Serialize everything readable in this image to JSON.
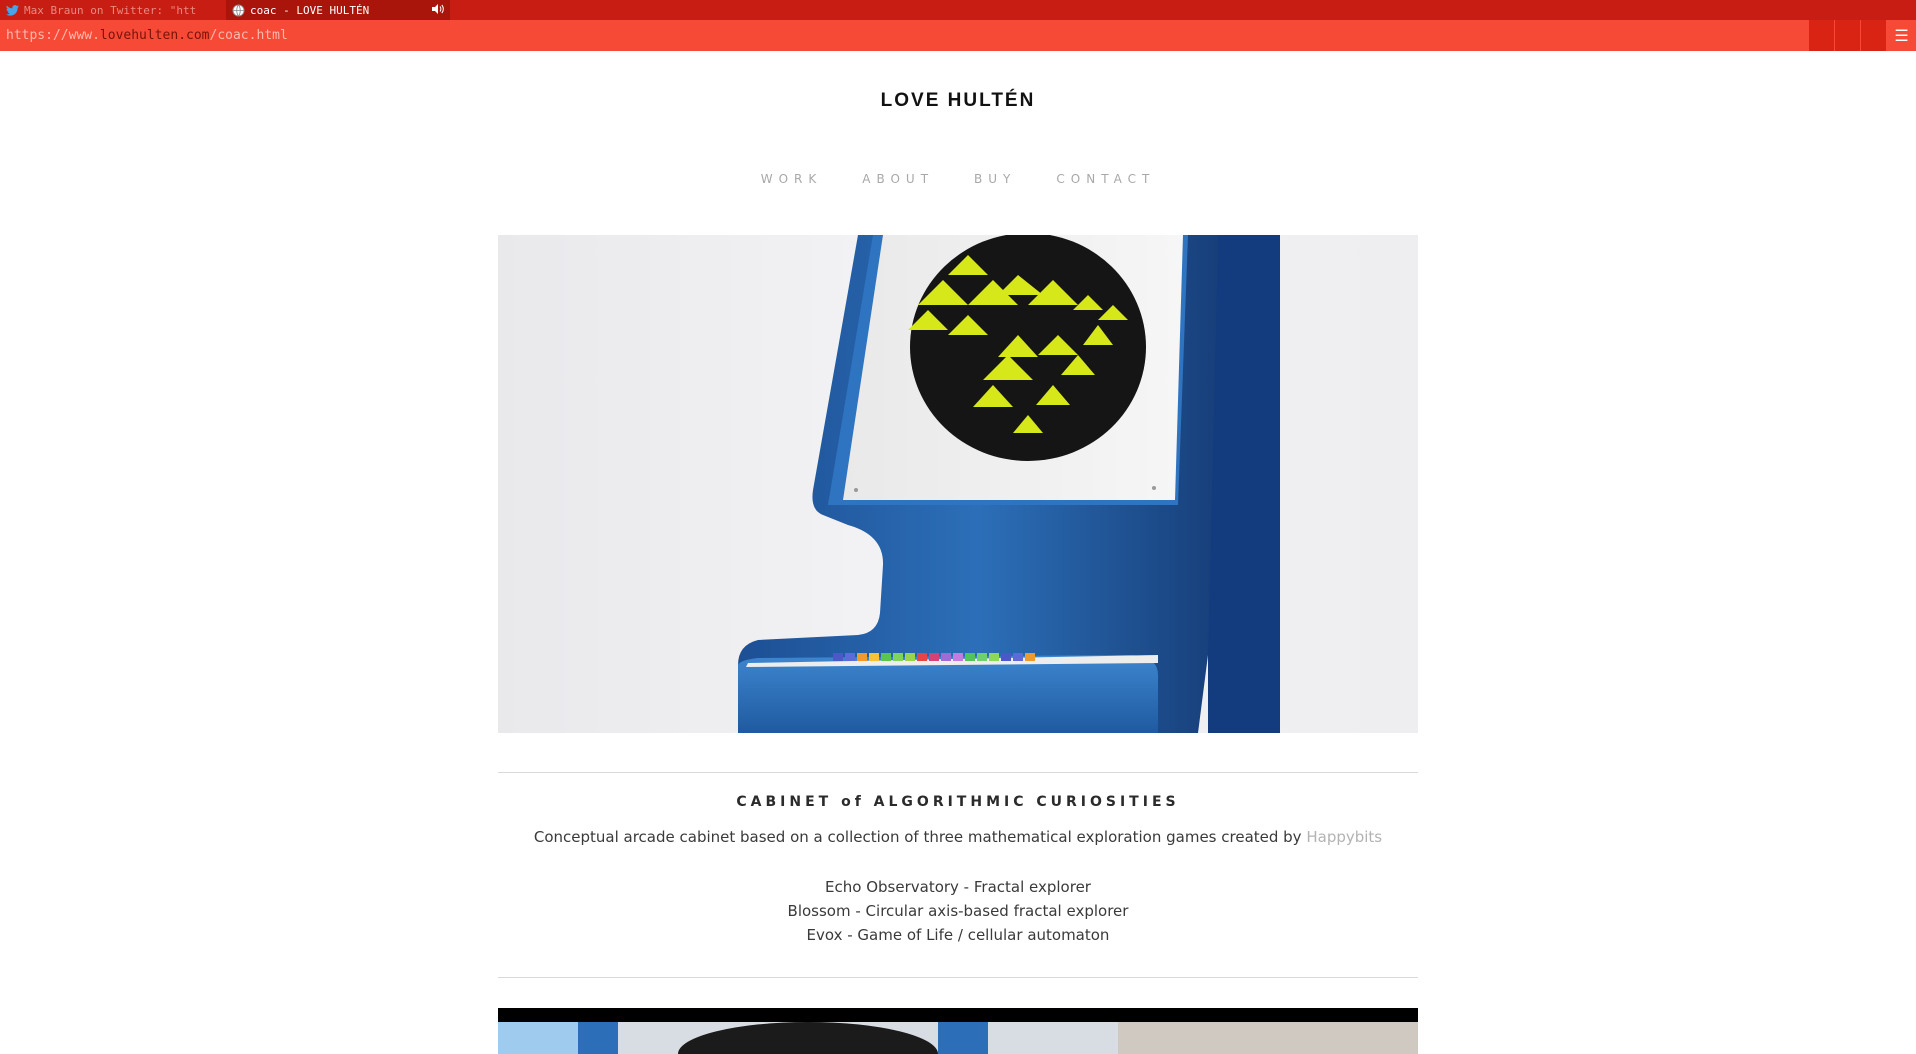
{
  "browser": {
    "tabs": [
      {
        "label": "Max Braun on Twitter: \"htt",
        "icon": "twitter-bird-icon",
        "active": false
      },
      {
        "label": "coac - LOVE HULTÉN",
        "icon": "globe-icon",
        "active": true,
        "audio_icon": "speaker-icon"
      }
    ],
    "url": {
      "prefix": "https://www.",
      "host": "lovehulten.com",
      "path": "/coac.html"
    },
    "menu_icon": "hamburger-menu-icon"
  },
  "site": {
    "title": "LOVE HULTÉN",
    "nav": [
      "WORK",
      "ABOUT",
      "BUY",
      "CONTACT"
    ]
  },
  "project": {
    "title": "CABINET of ALGORITHMIC CURIOSITIES",
    "description": "Conceptual arcade cabinet based on a collection of three mathematical exploration games created by",
    "creator_link": "Happybits",
    "games": [
      "Echo Observatory - Fractal explorer",
      "Blossom - Circular axis-based fractal explorer",
      "Evox - Game of Life / cellular automaton"
    ]
  },
  "colors": {
    "tabbar": "#c81d12",
    "urlbar": "#f64a36",
    "cabinet_blue": "#2c6fb8",
    "fractal_yellow": "#d7e81a"
  }
}
